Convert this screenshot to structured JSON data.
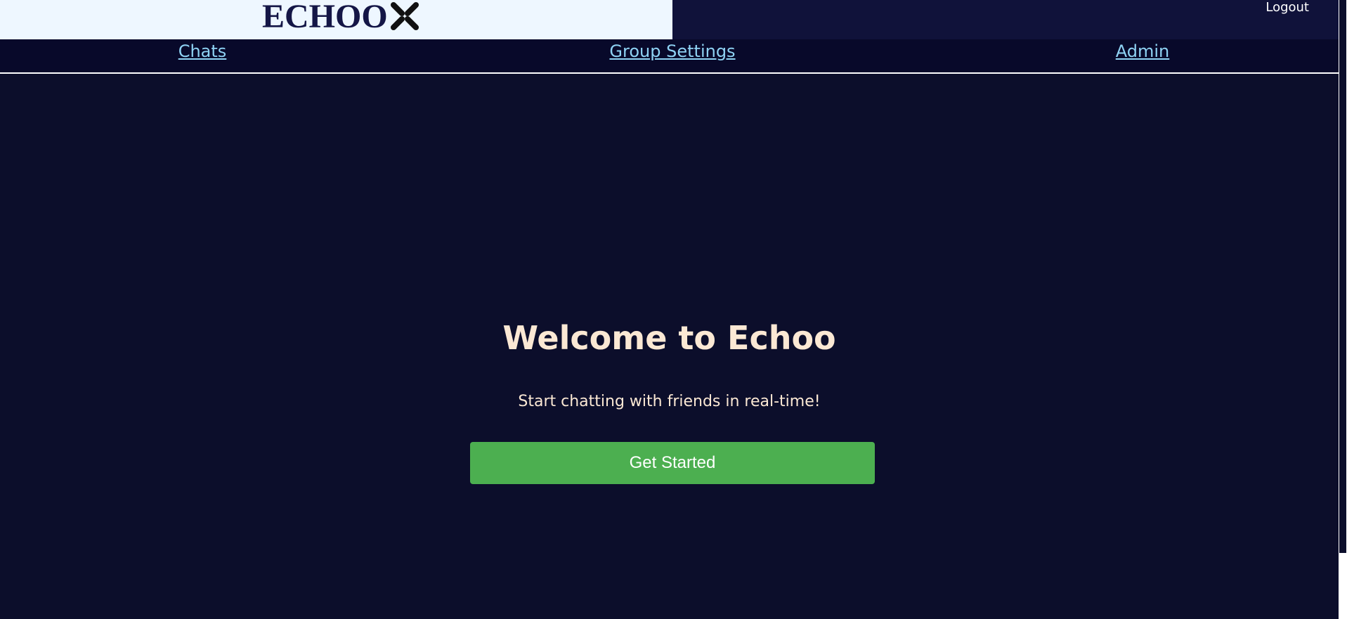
{
  "header": {
    "logo_text": "ECHOO",
    "logo_icon": "echoo-x-mark-icon",
    "logout_label": "Logout"
  },
  "nav": {
    "items": [
      {
        "label": "Chats"
      },
      {
        "label": "Group Settings"
      },
      {
        "label": "Admin"
      }
    ]
  },
  "hero": {
    "title": "Welcome to Echoo",
    "subtitle": "Start chatting with friends in real-time!",
    "cta_label": "Get Started"
  },
  "colors": {
    "background": "#0c0e2b",
    "logo_panel": "#eef7ff",
    "nav_link": "#8fd3f4",
    "hero_text": "#fbe8d4",
    "cta": "#4caf50"
  }
}
